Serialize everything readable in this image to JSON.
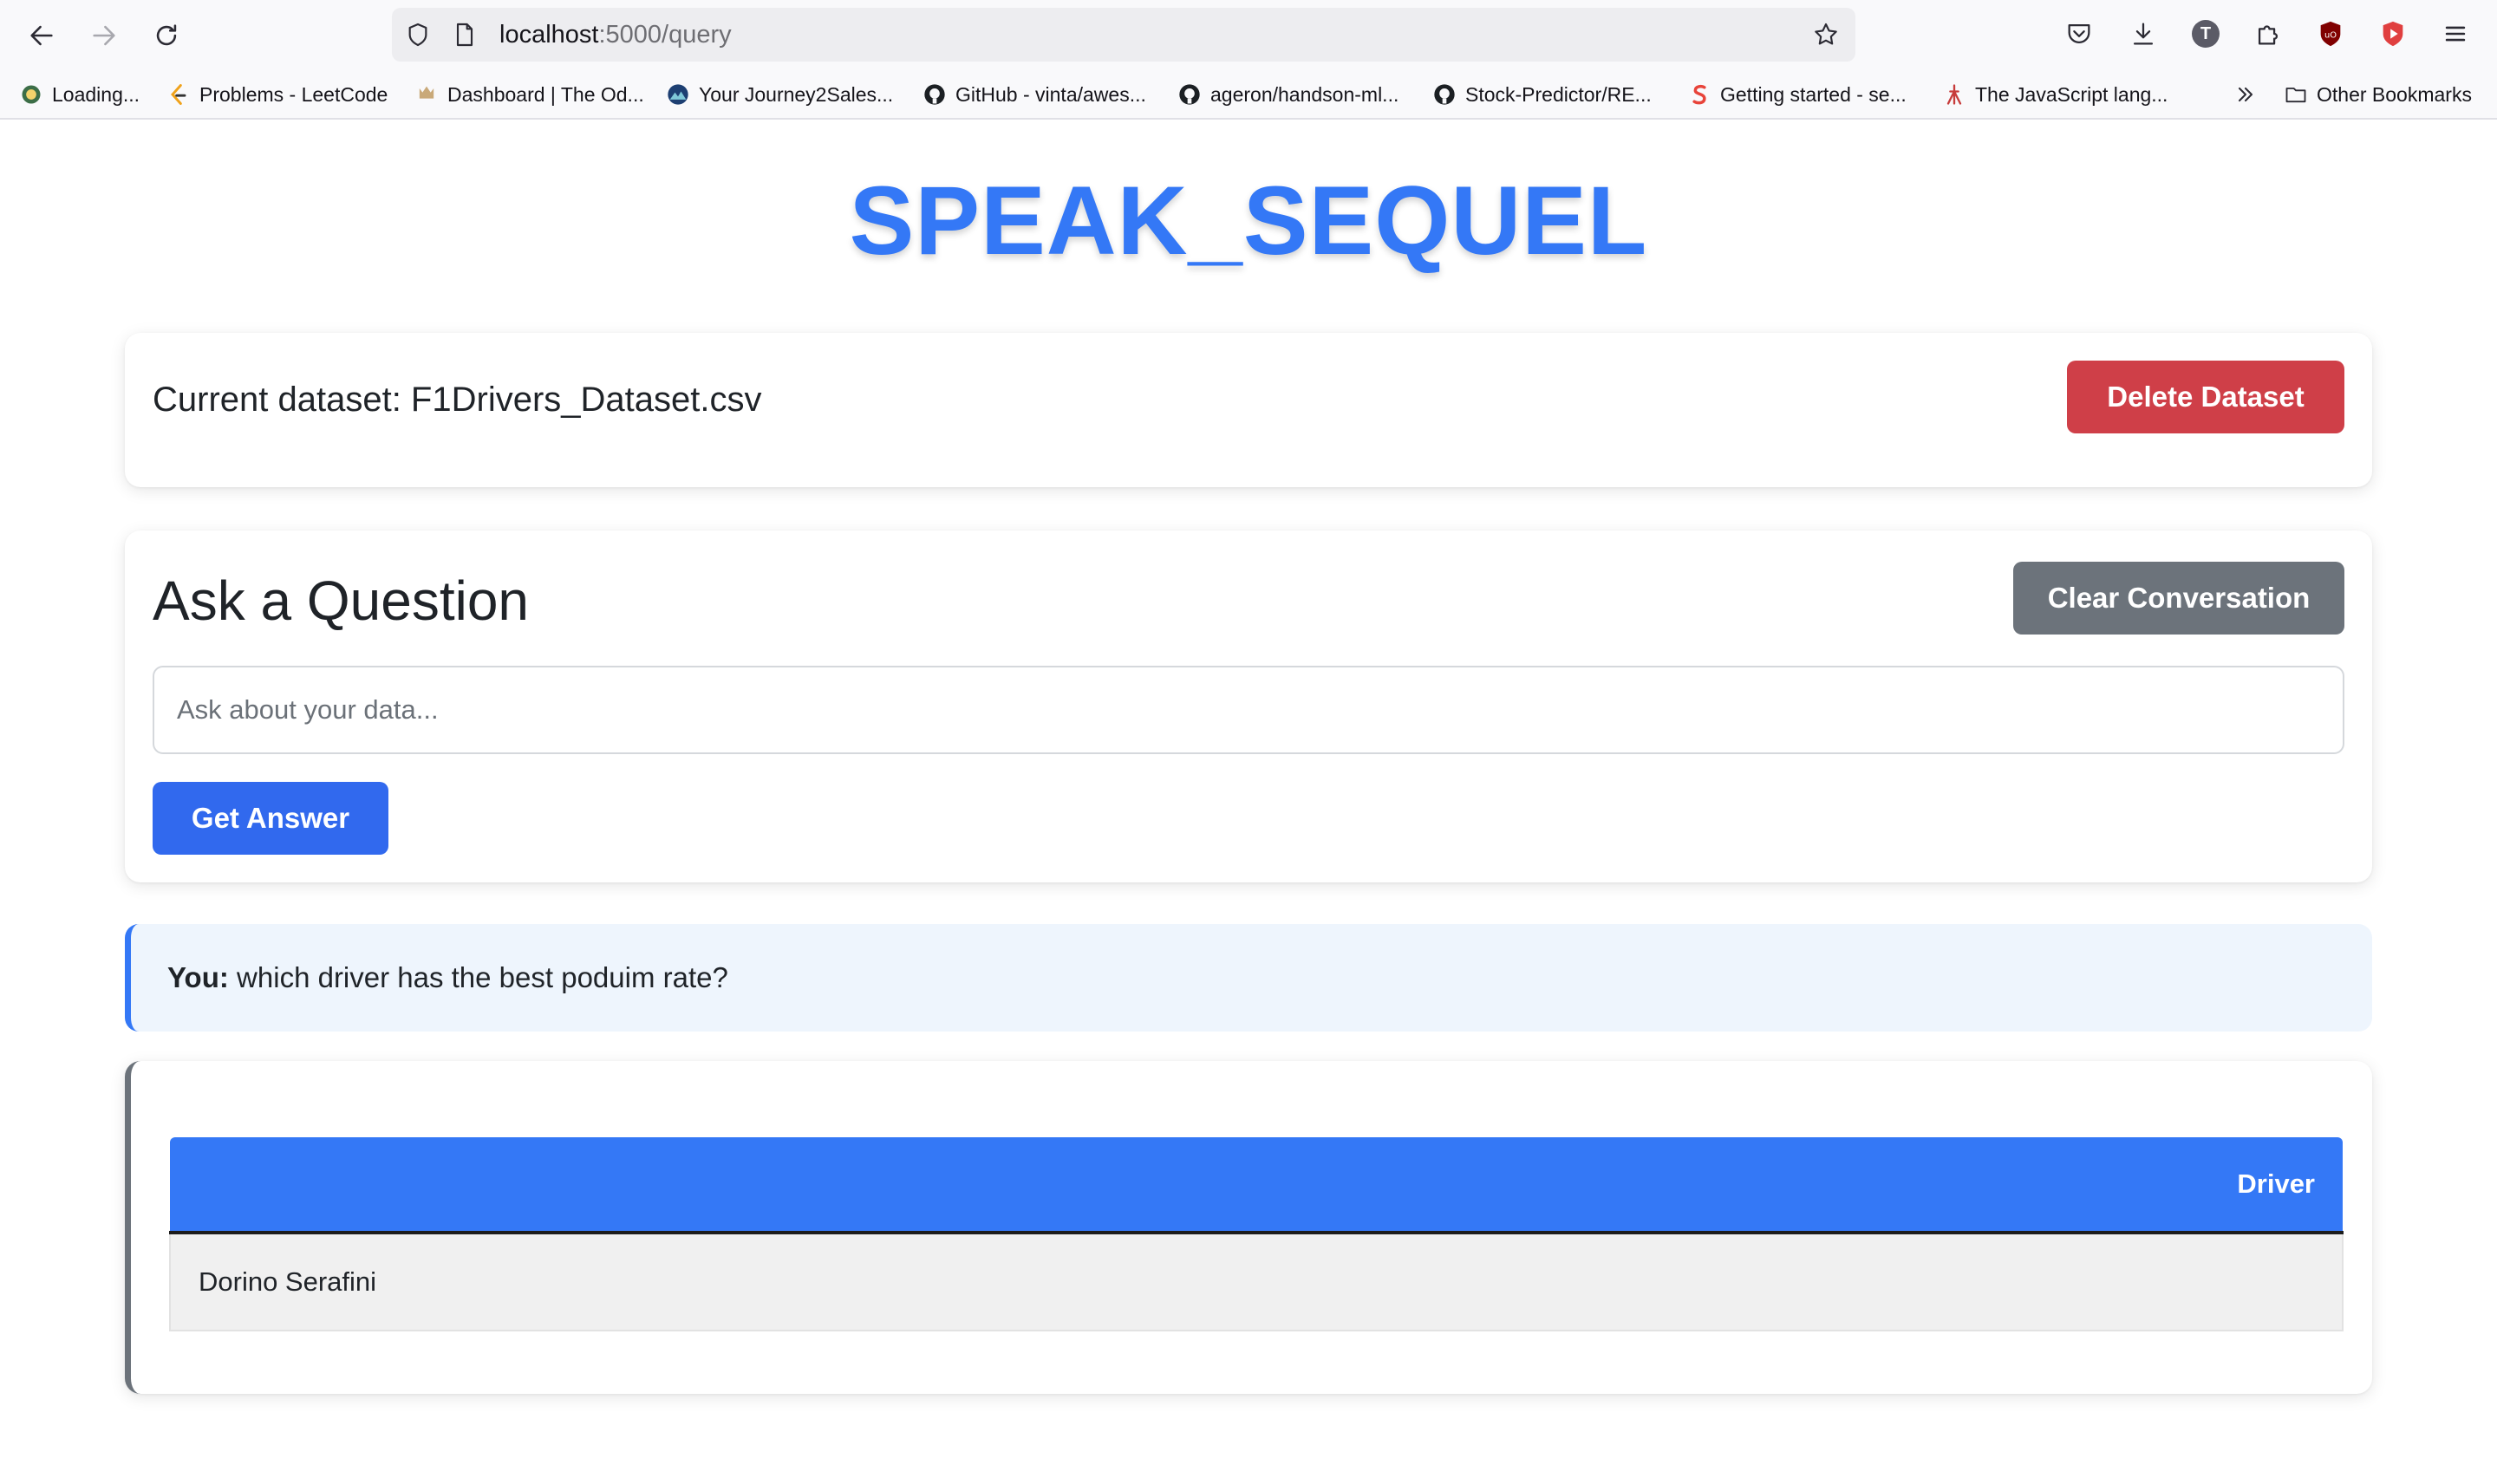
{
  "browser": {
    "url_host": "localhost",
    "url_path": ":5000/query",
    "bookmarks": [
      {
        "label": "Loading..."
      },
      {
        "label": "Problems - LeetCode"
      },
      {
        "label": "Dashboard | The Od..."
      },
      {
        "label": "Your Journey2Sales..."
      },
      {
        "label": "GitHub - vinta/awes..."
      },
      {
        "label": "ageron/handson-ml..."
      },
      {
        "label": "Stock-Predictor/RE..."
      },
      {
        "label": "Getting started - se..."
      },
      {
        "label": "The JavaScript lang..."
      }
    ],
    "other_bookmarks": "Other Bookmarks",
    "profile_initial": "T",
    "colors": {
      "brave_shield": "#e03f3f",
      "ublock": "#800000"
    }
  },
  "app": {
    "title": "SPEAK_SEQUEL",
    "dataset_label": "Current dataset: F1Drivers_Dataset.csv",
    "delete_button": "Delete Dataset",
    "ask_title": "Ask a Question",
    "clear_button": "Clear Conversation",
    "query_placeholder": "Ask about your data...",
    "query_value": "",
    "submit_button": "Get Answer",
    "conversation": {
      "user_prefix": "You:",
      "user_message": "which driver has the best poduim rate?"
    },
    "result_table": {
      "columns": [
        "Driver"
      ],
      "rows": [
        [
          "Dorino Serafini"
        ]
      ]
    },
    "colors": {
      "accent": "#3478f6",
      "danger": "#cf3f48",
      "secondary": "#6c737b",
      "primary_button": "#3169ee"
    }
  }
}
